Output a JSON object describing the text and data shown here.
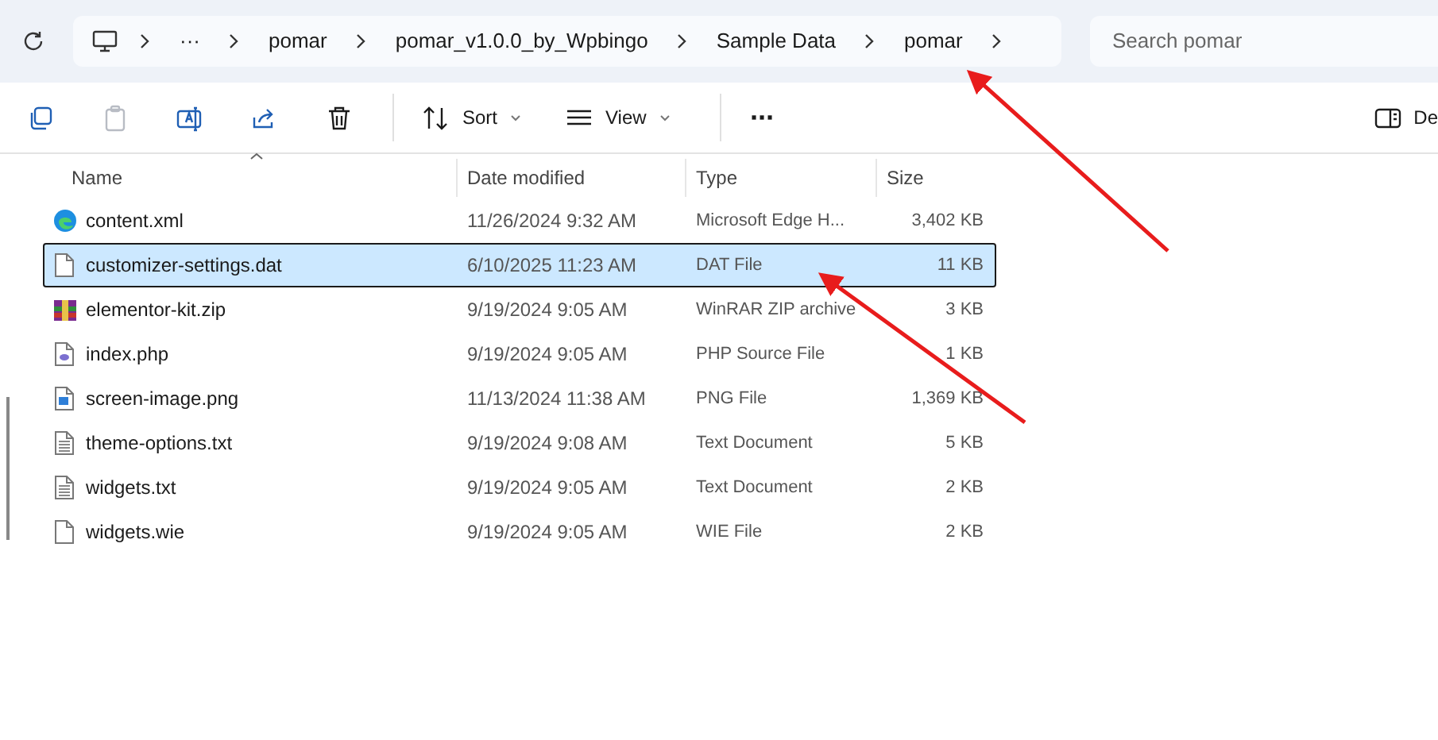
{
  "breadcrumbs": [
    "···",
    "pomar",
    "pomar_v1.0.0_by_Wpbingo",
    "Sample Data",
    "pomar"
  ],
  "search": {
    "placeholder": "Search pomar"
  },
  "toolbar": [
    {
      "kind": "copy",
      "disabled": false
    },
    {
      "kind": "paste",
      "disabled": true
    },
    {
      "kind": "rename",
      "disabled": false
    },
    {
      "kind": "share",
      "disabled": false
    },
    {
      "kind": "delete",
      "disabled": false
    },
    {
      "kind": "sort",
      "label": "Sort",
      "disabled": false
    },
    {
      "kind": "view",
      "label": "View",
      "disabled": false
    },
    {
      "kind": "more",
      "label": "···",
      "disabled": false
    },
    {
      "kind": "details",
      "label": "De",
      "disabled": false
    }
  ],
  "columns": [
    "Name",
    "Date modified",
    "Type",
    "Size"
  ],
  "files": [
    {
      "name": "content.xml",
      "date": "11/26/2024 9:32 AM",
      "type": "Microsoft Edge H...",
      "size": "3,402 KB",
      "kind": "edge",
      "selected": false
    },
    {
      "name": "customizer-settings.dat",
      "date": "6/10/2025 11:23 AM",
      "type": "DAT File",
      "size": "11 KB",
      "kind": "file",
      "selected": true
    },
    {
      "name": "elementor-kit.zip",
      "date": "9/19/2024 9:05 AM",
      "type": "WinRAR ZIP archive",
      "size": "3 KB",
      "kind": "zip",
      "selected": false
    },
    {
      "name": "index.php",
      "date": "9/19/2024 9:05 AM",
      "type": "PHP Source File",
      "size": "1 KB",
      "kind": "php",
      "selected": false
    },
    {
      "name": "screen-image.png",
      "date": "11/13/2024 11:38 AM",
      "type": "PNG File",
      "size": "1,369 KB",
      "kind": "png",
      "selected": false
    },
    {
      "name": "theme-options.txt",
      "date": "9/19/2024 9:08 AM",
      "type": "Text Document",
      "size": "5 KB",
      "kind": "text",
      "selected": false
    },
    {
      "name": "widgets.txt",
      "date": "9/19/2024 9:05 AM",
      "type": "Text Document",
      "size": "2 KB",
      "kind": "text",
      "selected": false
    },
    {
      "name": "widgets.wie",
      "date": "9/19/2024 9:05 AM",
      "type": "WIE File",
      "size": "2 KB",
      "kind": "file",
      "selected": false
    }
  ]
}
